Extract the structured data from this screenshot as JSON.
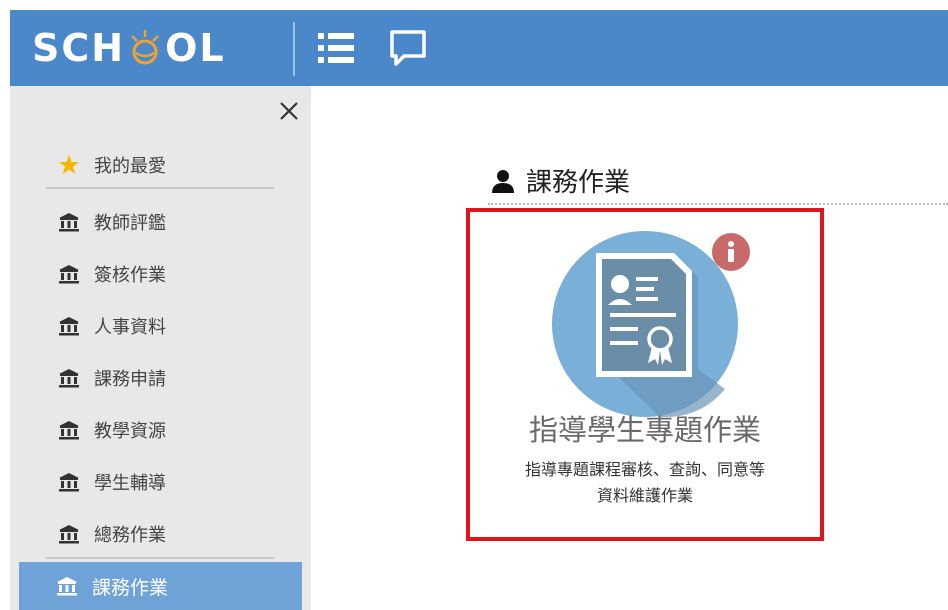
{
  "header": {
    "logo_left": "SCH",
    "logo_right": "OL",
    "menu_icon": "list-icon",
    "chat_icon": "chat-bubble-icon"
  },
  "sidebar": {
    "close_icon": "close-icon",
    "favorites": {
      "label": "我的最愛",
      "icon": "star-icon"
    },
    "items": [
      {
        "label": "教師評鑑",
        "icon": "institution-icon"
      },
      {
        "label": "簽核作業",
        "icon": "institution-icon"
      },
      {
        "label": "人事資料",
        "icon": "institution-icon"
      },
      {
        "label": "課務申請",
        "icon": "institution-icon"
      },
      {
        "label": "教學資源",
        "icon": "institution-icon"
      },
      {
        "label": "學生輔導",
        "icon": "institution-icon"
      },
      {
        "label": "總務作業",
        "icon": "institution-icon"
      }
    ],
    "active": {
      "label": "課務作業",
      "icon": "institution-icon"
    }
  },
  "main": {
    "section_title": "課務作業",
    "section_icon": "user-icon",
    "card": {
      "title": "指導學生專題作業",
      "desc_line1": "指導專題課程審核、查詢、同意等",
      "desc_line2": "資料維護作業",
      "icon": "certificate-document-icon",
      "badge_icon": "info-icon"
    }
  },
  "colors": {
    "header_bg": "#4a88c9",
    "sidebar_bg": "#e8e8e8",
    "active_bg": "#6fa3d8",
    "highlight_border": "#e0141c",
    "circle": "#7ab0d8",
    "badge": "#c96a6a"
  }
}
